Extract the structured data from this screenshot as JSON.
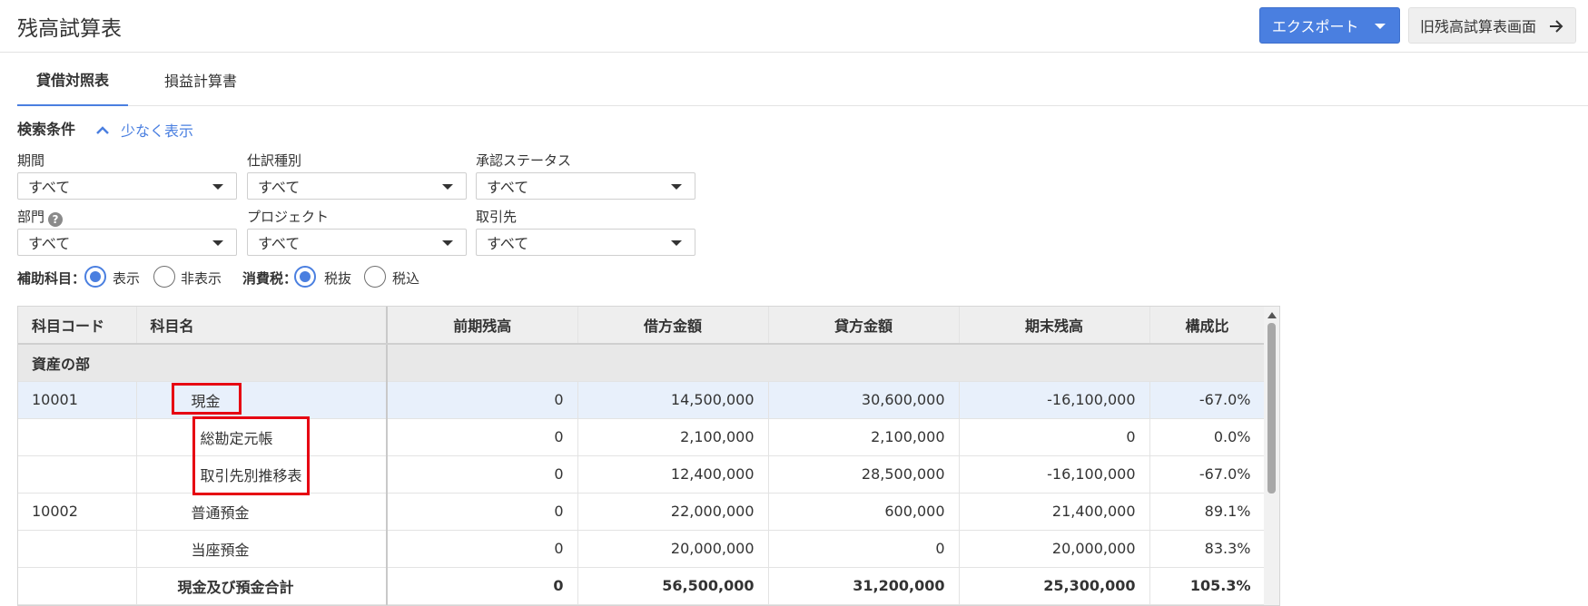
{
  "header": {
    "title": "残高試算表",
    "export_label": "エクスポート",
    "old_screen_label": "旧残高試算表画面"
  },
  "tabs": [
    {
      "label": "貸借対照表",
      "active": true
    },
    {
      "label": "損益計算書",
      "active": false
    }
  ],
  "search": {
    "label": "検索条件",
    "toggle_label": "少なく表示",
    "fields": [
      {
        "label": "期間",
        "value": "すべて"
      },
      {
        "label": "仕訳種別",
        "value": "すべて"
      },
      {
        "label": "承認ステータス",
        "value": "すべて"
      },
      {
        "label": "部門",
        "value": "すべて",
        "help": "?"
      },
      {
        "label": "プロジェクト",
        "value": "すべて"
      },
      {
        "label": "取引先",
        "value": "すべて"
      }
    ],
    "sub_account": {
      "label": "補助科目：",
      "options": [
        "表示",
        "非表示"
      ],
      "selected": "表示"
    },
    "tax": {
      "label": "消費税：",
      "options": [
        "税抜",
        "税込"
      ],
      "selected": "税抜"
    }
  },
  "table": {
    "columns": [
      "科目コード",
      "科目名",
      "前期残高",
      "借方金額",
      "貸方金額",
      "期末残高",
      "構成比"
    ],
    "section": "資産の部",
    "rows": [
      {
        "code": "10001",
        "name": "現金",
        "prev": "0",
        "debit": "14,500,000",
        "credit": "30,600,000",
        "end": "-16,100,000",
        "ratio": "-67.0%"
      },
      {
        "code": "",
        "name": "総勘定元帳",
        "prev": "0",
        "debit": "2,100,000",
        "credit": "2,100,000",
        "end": "0",
        "ratio": "0.0%"
      },
      {
        "code": "",
        "name": "取引先別推移表",
        "prev": "0",
        "debit": "12,400,000",
        "credit": "28,500,000",
        "end": "-16,100,000",
        "ratio": "-67.0%"
      },
      {
        "code": "10002",
        "name": "普通預金",
        "prev": "0",
        "debit": "22,000,000",
        "credit": "600,000",
        "end": "21,400,000",
        "ratio": "89.1%"
      },
      {
        "code": "",
        "name": "当座預金",
        "prev": "0",
        "debit": "20,000,000",
        "credit": "0",
        "end": "20,000,000",
        "ratio": "83.3%"
      },
      {
        "code": "",
        "name": "現金及び預金合計",
        "prev": "0",
        "debit": "56,500,000",
        "credit": "31,200,000",
        "end": "25,300,000",
        "ratio": "105.3%"
      }
    ]
  },
  "colors": {
    "accent": "#4a7fe0",
    "highlight": "#e60012"
  }
}
